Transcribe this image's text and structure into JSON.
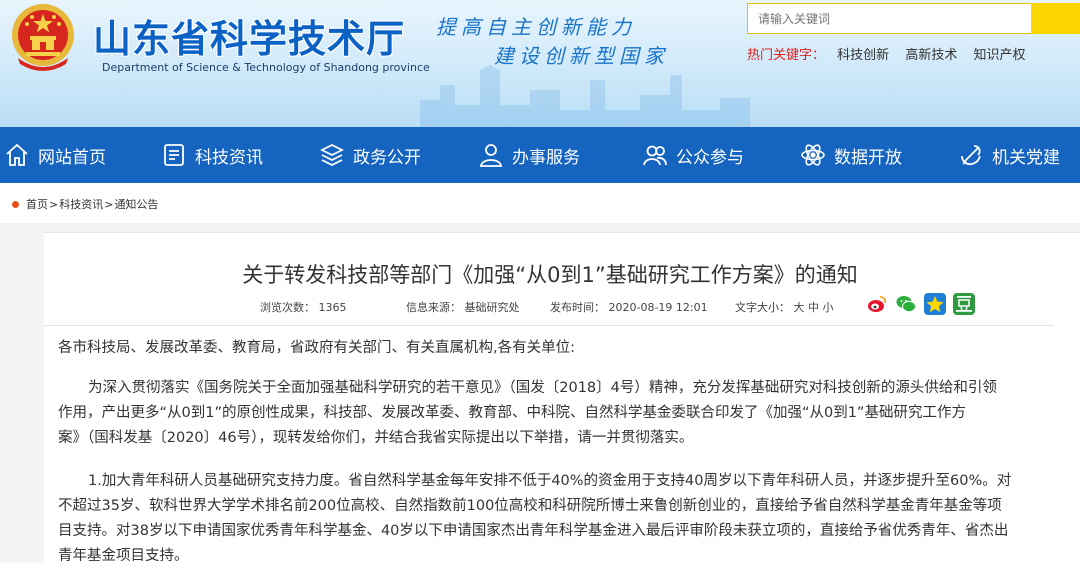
{
  "header": {
    "site_title": "山东省科学技术厅",
    "site_title_en": "Department of Science & Technology of Shandong province",
    "slogan_line1": "提高自主创新能力",
    "slogan_line2": "建设创新型国家",
    "search_placeholder": "请输入关键词",
    "hot_label": "热门关键字：",
    "hot_keywords": [
      "科技创新",
      "高新技术",
      "知识产权"
    ],
    "emblem_icon": "national-emblem-icon"
  },
  "nav": [
    {
      "label": "网站首页",
      "icon": "home-icon"
    },
    {
      "label": "科技资讯",
      "icon": "news-list-icon"
    },
    {
      "label": "政务公开",
      "icon": "layers-icon"
    },
    {
      "label": "办事服务",
      "icon": "person-service-icon"
    },
    {
      "label": "公众参与",
      "icon": "people-icon"
    },
    {
      "label": "数据开放",
      "icon": "atom-icon"
    },
    {
      "label": "机关党建",
      "icon": "party-emblem-icon"
    }
  ],
  "breadcrumb": {
    "items": [
      "首页",
      "科技资讯",
      "通知公告"
    ],
    "separator": ">"
  },
  "article": {
    "title": "关于转发科技部等部门《加强“从0到1”基础研究工作方案》的通知",
    "meta": {
      "views_label": "浏览次数：",
      "views": "1365",
      "source_label": "信息来源：",
      "source": "基础研究处",
      "date_label": "发布时间：",
      "date": "2020-08-19 12:01",
      "font_label": "文字大小：",
      "font_large": "大",
      "font_medium": "中",
      "font_small": "小"
    },
    "share_icons": [
      "weibo-icon",
      "wechat-icon",
      "qzone-star-icon",
      "douban-icon"
    ],
    "salutation": "各市科技局、发展改革委、教育局，省政府有关部门、有关直属机构,各有关单位:",
    "para1": [
      "为深入贯彻落实《国务院关于全面加强基础科学研究的若干意见》（国发〔2018〕4号）精神，充分发挥基础研究对科技创新的源头供给和引领",
      "作用，产出更多“从0到1”的原创性成果，科技部、发展改革委、教育部、中科院、自然科学基金委联合印发了《加强“从0到1”基础研究工作方",
      "案》（国科发基〔2020〕46号），现转发给你们，并结合我省实际提出以下举措，请一并贯彻落实。"
    ],
    "para2": [
      "1.加大青年科研人员基础研究支持力度。省自然科学基金每年安排不低于40%的资金用于支持40周岁以下青年科研人员，并逐步提升至60%。对",
      "不超过35岁、软科世界大学学术排名前200位高校、自然指数前100位高校和科研院所博士来鲁创新创业的，直接给予省自然科学基金青年基金等项",
      "目支持。对38岁以下申请国家优秀青年科学基金、40岁以下申请国家杰出青年科学基金进入最后评审阶段未获立项的，直接给予省优秀青年、省杰出",
      "青年基金项目支持。"
    ]
  },
  "colors": {
    "brand_blue": "#1464c0",
    "title_blue": "#0b62c4",
    "hot_red": "#e02020",
    "search_yellow": "#fcd600",
    "crumb_dot": "#e8501a"
  }
}
